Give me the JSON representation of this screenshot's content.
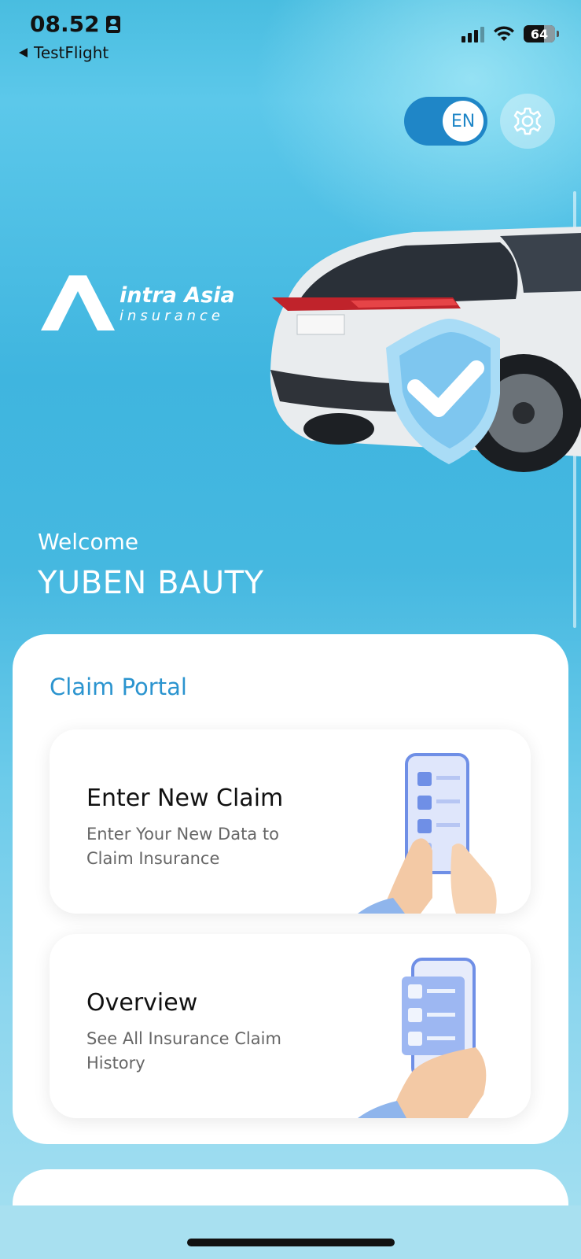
{
  "status_bar": {
    "time": "08.52",
    "back_app": "TestFlight",
    "battery": "64"
  },
  "header": {
    "language": "EN"
  },
  "brand": {
    "name": "intra Asia",
    "sub": "insurance"
  },
  "welcome": {
    "label": "Welcome",
    "user_name": "YUBEN BAUTY"
  },
  "claim_portal": {
    "title": "Claim Portal",
    "items": [
      {
        "title": "Enter New Claim",
        "description": "Enter Your New Data to Claim Insurance"
      },
      {
        "title": "Overview",
        "description": "See All Insurance Claim History"
      }
    ]
  },
  "colors": {
    "accent": "#2b94cf",
    "toggle": "#1f86c7",
    "background": "#45b8e0"
  }
}
